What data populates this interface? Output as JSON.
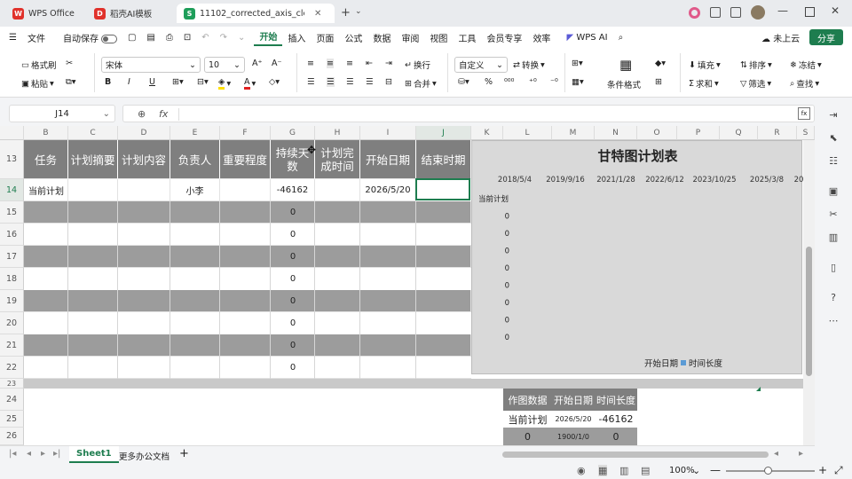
{
  "tabs": [
    {
      "label": "WPS Office",
      "icon": "wps-logo-icon"
    },
    {
      "label": "稻壳AI模板",
      "icon": "docer-logo-icon"
    },
    {
      "label": "11102_corrected_axis_clea",
      "icon": "sheet-file-icon"
    }
  ],
  "menu": {
    "file": "文件",
    "autosave": "自动保存",
    "items": [
      "开始",
      "插入",
      "页面",
      "公式",
      "数据",
      "审阅",
      "视图",
      "工具",
      "会员专享",
      "效率"
    ],
    "active": "开始",
    "wps_ai": "WPS AI",
    "cloud": "未上云",
    "share": "分享"
  },
  "ribbon": {
    "format_painter": "格式刷",
    "paste": "粘贴",
    "font_name": "宋体",
    "font_size": "10",
    "wrap": "换行",
    "merge": "合并",
    "number_format": "自定义",
    "convert": "转换",
    "cond_format": "条件格式",
    "fill": "填充",
    "sort": "排序",
    "freeze": "冻结",
    "sum": "求和",
    "filter": "筛选",
    "find": "查找"
  },
  "formula": {
    "cell_ref": "J14",
    "fx": "fx",
    "value": ""
  },
  "columns": [
    "B",
    "C",
    "D",
    "E",
    "F",
    "G",
    "H",
    "I",
    "J",
    "K",
    "L",
    "M",
    "N",
    "O",
    "P",
    "Q",
    "R",
    "S"
  ],
  "rows": [
    "13",
    "14",
    "15",
    "16",
    "17",
    "18",
    "19",
    "20",
    "21",
    "22",
    "23",
    "24",
    "25",
    "26"
  ],
  "headers": {
    "B": "任务",
    "C": "计划摘要",
    "D": "计划内容",
    "E": "负责人",
    "F": "重要程度",
    "G1": "持续天",
    "G2": "数",
    "H1": "计划完",
    "H2": "成时间",
    "I": "开始日期",
    "J": "结束时期"
  },
  "row14": {
    "B": "当前计划",
    "E": "小李",
    "G": "-46162",
    "I": "2026/5/20"
  },
  "g_zeros": [
    "0",
    "0",
    "0",
    "0",
    "0",
    "0",
    "0",
    "0"
  ],
  "chart_data": {
    "type": "bar",
    "title": "甘特图计划表",
    "x_ticks": [
      "2018/5/4",
      "2019/9/16",
      "2021/1/28",
      "2022/6/12",
      "2023/10/25",
      "2025/3/8",
      "20"
    ],
    "categories": [
      "当前计划",
      "0",
      "0",
      "0",
      "0",
      "0",
      "0",
      "0",
      "0"
    ],
    "series": [
      {
        "name": "开始日期",
        "values": [
          46162,
          0,
          0,
          0,
          0,
          0,
          0,
          0,
          0
        ],
        "color": "#d9d9d9"
      },
      {
        "name": "时间长度",
        "values": [
          -46162,
          0,
          0,
          0,
          0,
          0,
          0,
          0,
          0
        ],
        "color": "#5b9bd5"
      }
    ],
    "legend": "bottom-right",
    "grid": false
  },
  "table2": {
    "headers": [
      "作图数据",
      "开始日期",
      "时间长度"
    ],
    "row1": [
      "当前计划",
      "2026/5/20",
      "-46162"
    ],
    "row2": [
      "0",
      "1900/1/0",
      "0"
    ]
  },
  "sheets": {
    "active": "Sheet1",
    "other": "更多办公文档"
  },
  "status": {
    "zoom": "100%"
  }
}
